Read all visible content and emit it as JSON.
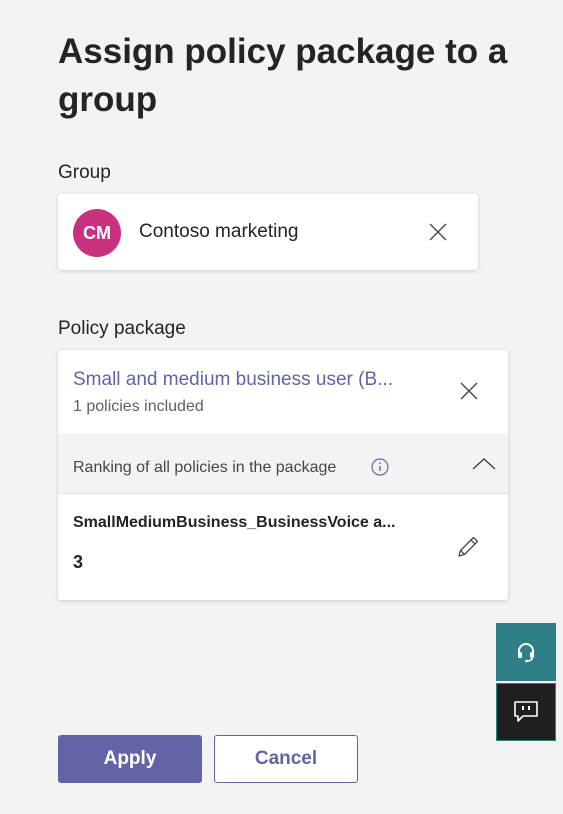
{
  "dialog": {
    "title": "Assign policy package to a group"
  },
  "group": {
    "label": "Group",
    "avatar_initials": "CM",
    "avatar_color": "#c8317e",
    "name": "Contoso marketing",
    "remove_icon": "close-icon"
  },
  "policy_package": {
    "label": "Policy package",
    "name": "Small and medium business user (B...",
    "count_text": "1 policies included",
    "remove_icon": "close-icon",
    "ranking": {
      "text": "Ranking of all policies in the package",
      "info_icon": "info-icon",
      "toggle_icon": "chevron-up-icon",
      "policies": [
        {
          "name": "SmallMediumBusiness_BusinessVoice a...",
          "rank": "3",
          "edit_icon": "pencil-icon"
        }
      ]
    }
  },
  "side_actions": {
    "help_icon": "headset-icon",
    "help_color": "#2f7f86",
    "feedback_icon": "feedback-icon"
  },
  "footer": {
    "apply_label": "Apply",
    "cancel_label": "Cancel"
  },
  "colors": {
    "accent": "#6264a7",
    "background": "#f3f3f3"
  }
}
